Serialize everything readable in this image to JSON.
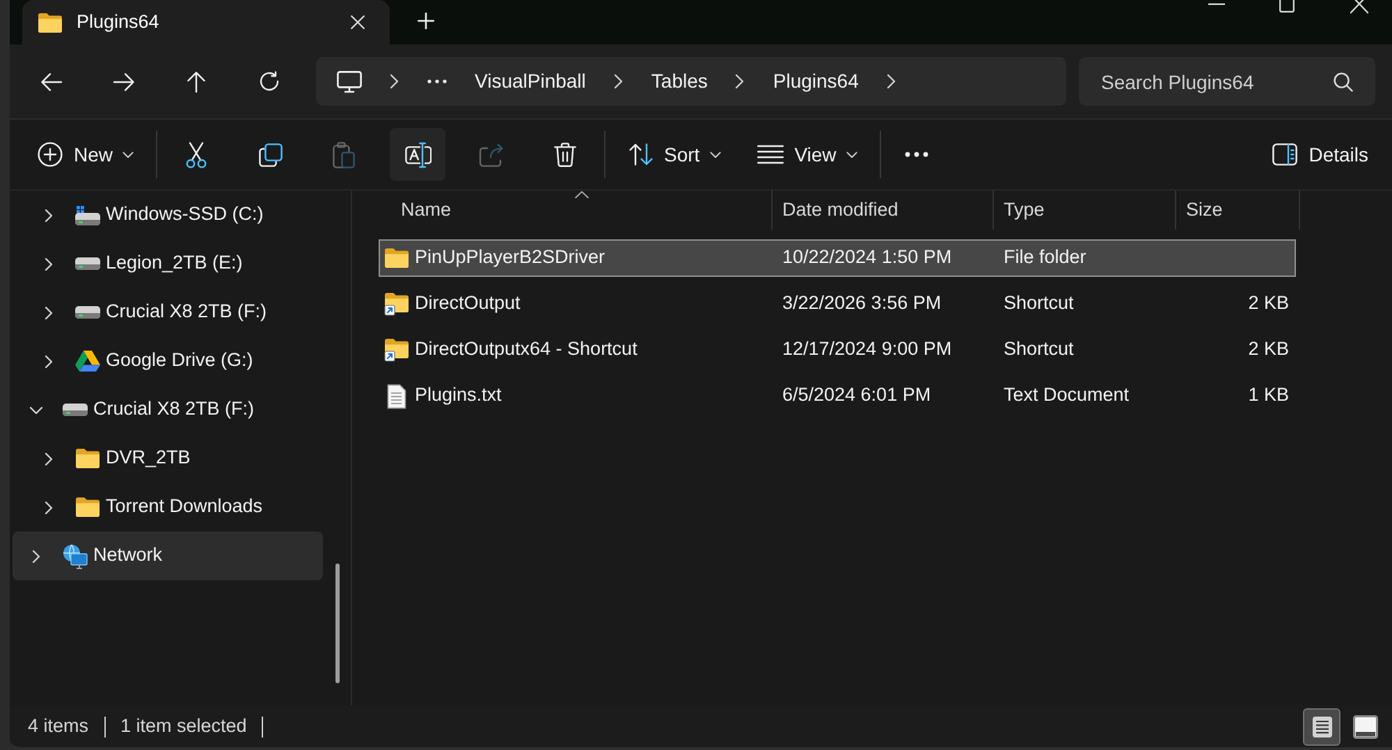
{
  "tabs": [
    {
      "label": "Plugins64",
      "selected": true
    }
  ],
  "address_bar": {
    "segments": [
      "VisualPinball",
      "Tables",
      "Plugins64"
    ]
  },
  "search": {
    "placeholder": "Search Plugins64"
  },
  "command_bar": {
    "groups": [
      [
        {
          "kind": "new",
          "label": "New",
          "disabled": false,
          "hovered": false
        }
      ],
      [
        {
          "kind": "cut",
          "disabled": false,
          "hovered": false
        },
        {
          "kind": "copy",
          "disabled": false,
          "hovered": false
        },
        {
          "kind": "paste",
          "disabled": true,
          "hovered": false
        },
        {
          "kind": "rename",
          "disabled": false,
          "hovered": true
        },
        {
          "kind": "share",
          "disabled": true,
          "hovered": false
        },
        {
          "kind": "delete",
          "disabled": false,
          "hovered": false
        }
      ],
      [
        {
          "kind": "sort",
          "label": "Sort",
          "disabled": false,
          "hovered": false
        },
        {
          "kind": "view",
          "label": "View",
          "disabled": false,
          "hovered": false
        }
      ],
      [
        {
          "kind": "more",
          "disabled": false,
          "hovered": false
        }
      ]
    ],
    "details": {
      "label": "Details"
    }
  },
  "sidebar": {
    "items": [
      {
        "children": [
          {
            "kind": "system-drive",
            "label": "Windows-SSD (C:)",
            "expanded": false,
            "selected": false
          },
          {
            "kind": "drive",
            "label": "Legion_2TB (E:)",
            "expanded": false,
            "selected": false
          },
          {
            "kind": "drive",
            "label": "Crucial X8 2TB (F:)",
            "expanded": false,
            "selected": false
          },
          {
            "kind": "cloud-drive",
            "label": "Google Drive (G:)",
            "expanded": false,
            "selected": false
          }
        ]
      },
      {
        "kind": "drive",
        "label": "Crucial X8 2TB (F:)",
        "expanded": true,
        "selected": false,
        "children": [
          {
            "kind": "folder",
            "label": "DVR_2TB",
            "expanded": false,
            "selected": false
          },
          {
            "kind": "folder",
            "label": "Torrent Downloads",
            "expanded": false,
            "selected": false
          }
        ]
      },
      {
        "kind": "network",
        "label": "Network",
        "expanded": false,
        "selected": true
      }
    ]
  },
  "table": {
    "columns": [
      {
        "label": "Name",
        "sorted": true
      },
      {
        "label": "Date modified",
        "sorted": false
      },
      {
        "label": "Type",
        "sorted": false
      },
      {
        "label": "Size",
        "sorted": false
      }
    ],
    "rows": [
      {
        "kind": "folder",
        "name": "PinUpPlayerB2SDriver",
        "date_modified": "10/22/2024 1:50 PM",
        "type": "File folder",
        "selected": true
      },
      {
        "kind": "shortcut",
        "name": "DirectOutput",
        "date_modified": "3/22/2026 3:56 PM",
        "type": "Shortcut",
        "size": "2 KB",
        "selected": false
      },
      {
        "kind": "shortcut",
        "name": "DirectOutputx64 - Shortcut",
        "date_modified": "12/17/2024 9:00 PM",
        "type": "Shortcut",
        "size": "2 KB",
        "selected": false
      },
      {
        "kind": "text",
        "name": "Plugins.txt",
        "date_modified": "6/5/2024 6:01 PM",
        "type": "Text Document",
        "size": "1 KB",
        "selected": false
      }
    ]
  },
  "status_bar": {
    "item_count": "4 items",
    "selection": "1 item selected",
    "views": [
      {
        "kind": "details",
        "selected": true
      },
      {
        "kind": "tiles",
        "selected": false
      }
    ]
  }
}
